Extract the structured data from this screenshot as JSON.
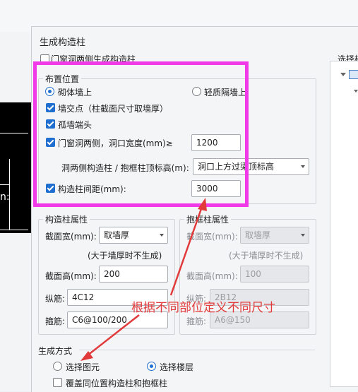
{
  "dialog": {
    "title": "生成构造柱",
    "hidden_checkbox_label": "门窗洞两侧生成构造柱",
    "right_panel_label": "选择楼"
  },
  "layout_group": {
    "title": "布置位置",
    "radio_brick_wall": "砌体墙上",
    "radio_light_wall": "轻质隔墙上",
    "check_intersection": "墙交点（柱截面尺寸取墙厚）",
    "check_isolated_end": "孤墙端头",
    "check_door_window": "门窗洞两侧，洞口宽度(mm)≥",
    "door_window_width": "1200",
    "top_elevation_label": "洞两侧构造柱 / 抱框柱顶标高(m):",
    "top_elevation_value": "洞口上方过梁顶标高",
    "check_spacing": "构造柱间距(mm):",
    "spacing_value": "3000"
  },
  "column_props": {
    "title": "构造柱属性",
    "width_label": "截面宽(mm):",
    "width_value": "取墙厚",
    "hint": "(大于墙厚时不生成)",
    "height_label": "截面高(mm):",
    "height_value": "200",
    "rebar_label": "纵筋:",
    "rebar_value": "4C12",
    "stirrup_label": "箍筋:",
    "stirrup_value": "C6@100/200"
  },
  "frame_props": {
    "title": "抱框柱属性",
    "width_label": "截面宽(mm):",
    "width_value": "取墙厚",
    "hint": "(大于墙厚时不生成)",
    "height_label": "截面高(mm):",
    "height_value": "100",
    "rebar_label": "纵筋:",
    "rebar_value": "2B12",
    "stirrup_label": "箍筋:",
    "stirrup_value": "A6@150"
  },
  "gen_mode": {
    "title": "生成方式",
    "radio_select_element": "选择图元",
    "radio_select_floor": "选择楼层",
    "check_override": "覆盖同位置构造柱和抱框柱"
  },
  "annotation": {
    "text": "根据不同部位定义不同尺寸",
    "color": "#e23a3a",
    "highlight_color": "#f03ae8"
  },
  "background": {
    "canvas_glyph": "n:"
  }
}
